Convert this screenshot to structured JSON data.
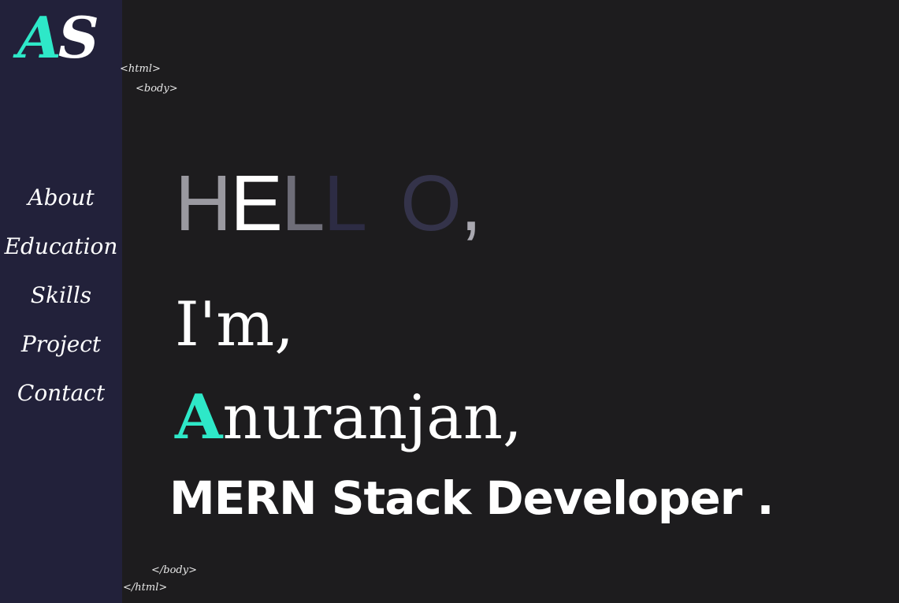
{
  "logo": {
    "letter1": "A",
    "letter2": "S"
  },
  "nav": {
    "items": [
      {
        "label": "About"
      },
      {
        "label": "Education"
      },
      {
        "label": "Skills"
      },
      {
        "label": "Project"
      },
      {
        "label": "Contact"
      }
    ]
  },
  "tags": {
    "html_open": "<html>",
    "body_open": "<body>",
    "body_close": "</body>",
    "html_close": "</html>"
  },
  "hero": {
    "hello_letters": [
      "H",
      "E",
      "L",
      "L",
      "",
      "O",
      ","
    ],
    "im": "I'm,",
    "name_first_letter": "A",
    "name_rest": "nuranjan,",
    "role": "MERN Stack Developer ."
  },
  "colors": {
    "accent": "#2ee8c8",
    "sidebar_bg": "#22213a",
    "page_bg": "#1d1c1e"
  }
}
